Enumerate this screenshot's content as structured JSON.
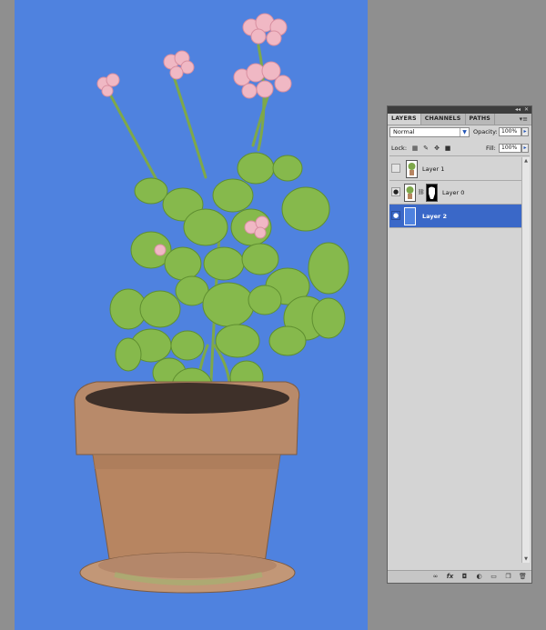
{
  "layers_panel": {
    "tabs": [
      "LAYERS",
      "CHANNELS",
      "PATHS"
    ],
    "active_tab": "LAYERS",
    "blend_mode": "Normal",
    "opacity_label": "Opacity:",
    "opacity_value": "100%",
    "lock_label": "Lock:",
    "fill_label": "Fill:",
    "fill_value": "100%",
    "layers": [
      {
        "name": "Layer 1",
        "visible": false,
        "selected": false,
        "has_mask": false
      },
      {
        "name": "Layer 0",
        "visible": true,
        "selected": false,
        "has_mask": true
      },
      {
        "name": "Layer 2",
        "visible": true,
        "selected": true,
        "has_mask": false
      }
    ],
    "footer_buttons": [
      "link-icon",
      "fx-icon",
      "mask-icon",
      "adjustment-icon",
      "group-icon",
      "new-layer-icon",
      "trash-icon"
    ]
  },
  "colors": {
    "canvas_background": "#4f82df",
    "workspace": "#8f8f8f",
    "selected_layer": "#3a68c8"
  }
}
